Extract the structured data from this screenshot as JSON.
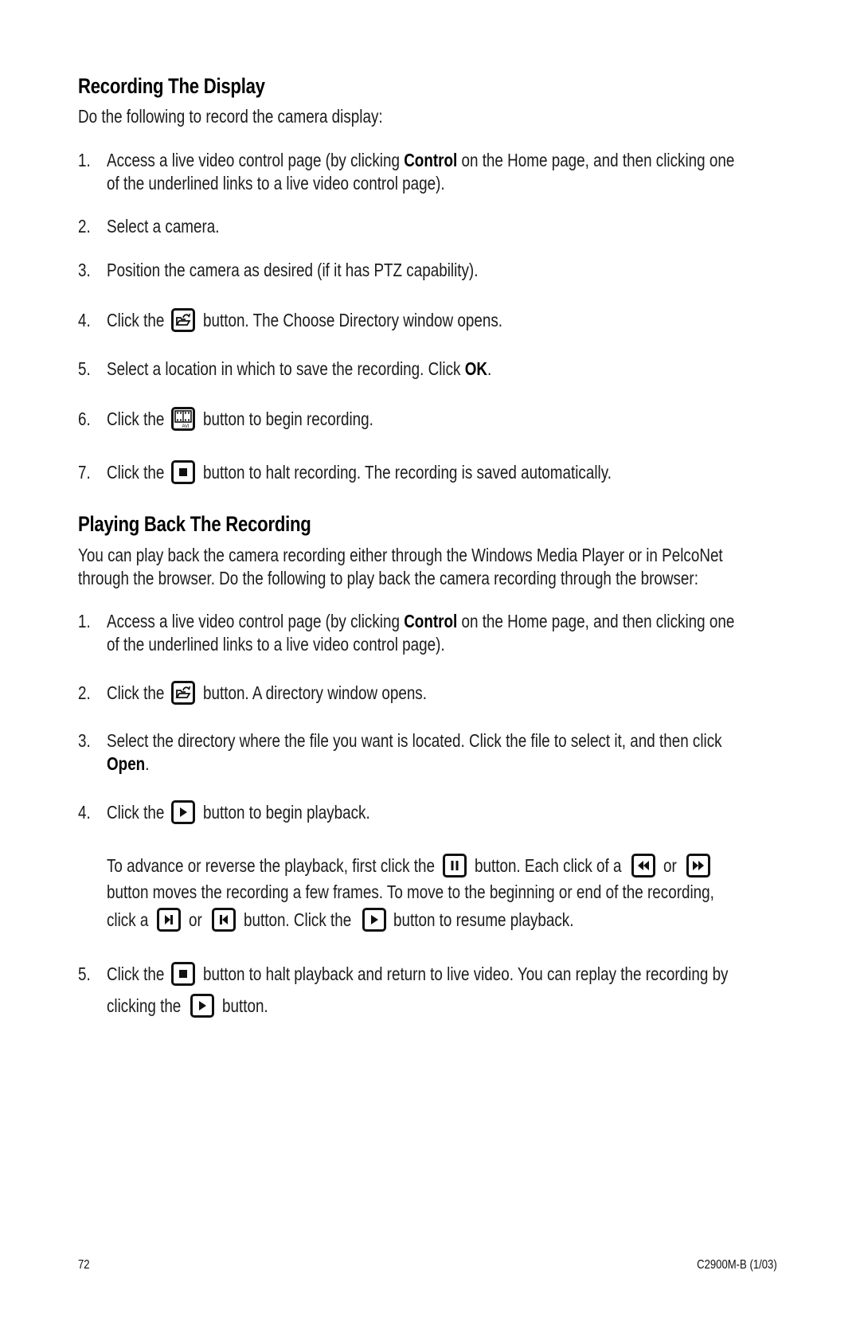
{
  "section1": {
    "heading": "Recording The Display",
    "intro": "Do the following to record the camera display:",
    "steps": [
      {
        "num": "1.",
        "pre": "Access a live video control page (by clicking ",
        "bold": "Control",
        "post": " on the Home page, and then clicking one",
        "line2": "of the underlined links to a live video control page)."
      },
      {
        "num": "2.",
        "text": "Select a camera."
      },
      {
        "num": "3.",
        "text": "Position the camera as desired (if it has PTZ capability)."
      },
      {
        "num": "4.",
        "pre": "Click the",
        "icon": "open-folder-icon",
        "post": "button. The Choose Directory window opens."
      },
      {
        "num": "5.",
        "pre": "Select a location in which to save the recording. Click ",
        "bold": "OK",
        "post": "."
      },
      {
        "num": "6.",
        "pre": "Click the",
        "icon": "record-avi-icon",
        "post": "button to begin recording.",
        "icon_label": "AVI"
      },
      {
        "num": "7.",
        "pre": "Click the",
        "icon": "stop-icon",
        "post": "button to halt recording. The recording is saved automatically."
      }
    ]
  },
  "section2": {
    "heading": "Playing Back The Recording",
    "intro_line1": "You can play back the camera recording either through the Windows Media Player or in PelcoNet",
    "intro_line2": "through the browser. Do the following to play back the camera recording through the browser:",
    "steps": [
      {
        "num": "1.",
        "pre": "Access a live video control page (by clicking ",
        "bold": "Control",
        "post": " on the Home page, and then clicking one",
        "line2": "of the underlined links to a live video control page)."
      },
      {
        "num": "2.",
        "pre": "Click the",
        "icon": "open-folder-icon",
        "post": "button. A directory window opens."
      },
      {
        "num": "3.",
        "line1": "Select the directory where the file you want is located. Click the file to select it, and then click",
        "bold": "Open",
        "post": "."
      },
      {
        "num": "4.",
        "pre": "Click the",
        "icon": "play-icon",
        "post": "button to begin playback."
      },
      {
        "num": "5.",
        "pre": "Click the",
        "icon": "stop-icon",
        "post": "button to halt playback and return to live video. You can replay the recording by",
        "line2_pre": "clicking the",
        "line2_post": "button."
      }
    ],
    "advance_note": {
      "l1_a": "To advance or reverse the playback, first click the",
      "l1_b": "button. Each click of a",
      "l1_c": "or",
      "l2": "button moves the recording a few frames. To move to the beginning or end of the recording,",
      "l3_a": "click a",
      "l3_b": "or",
      "l3_c": "button. Click the",
      "l3_d": "button to resume playback."
    }
  },
  "footer": {
    "page_number": "72",
    "doc_id": "C2900M-B (1/03)"
  }
}
